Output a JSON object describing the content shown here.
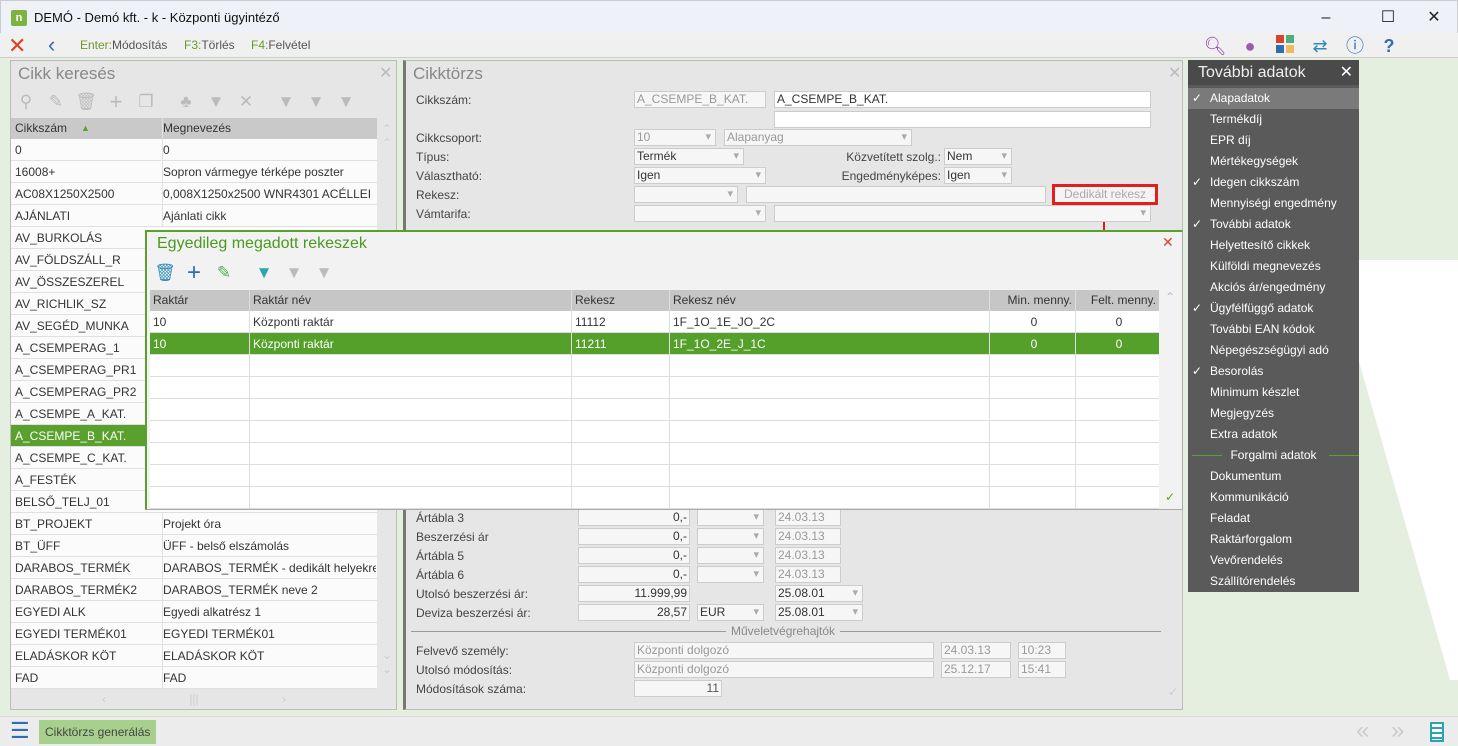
{
  "window": {
    "title": "DEMÓ - Demó kft. - k - Központi ügyintéző",
    "logo": "n"
  },
  "toolbar": {
    "keys": [
      {
        "key": "Enter:",
        "label": "Módosítás"
      },
      {
        "key": "F3:",
        "label": "Törlés"
      },
      {
        "key": "F4:",
        "label": "Felvétel"
      }
    ]
  },
  "search_panel": {
    "title": "Cikk keresés",
    "col1": "Cikkszám",
    "col2": "Megnevezés",
    "rows": [
      [
        "0",
        "0"
      ],
      [
        "16008+",
        "Sopron vármegye térképe poszter"
      ],
      [
        "AC08X1250X2500",
        "0,008X1250x2500 WNR4301 ACÉLLEI"
      ],
      [
        "AJÁNLATI",
        "Ajánlati cikk"
      ],
      [
        "AV_BURKOLÁS",
        ""
      ],
      [
        "AV_FÖLDSZÁLL_R",
        ""
      ],
      [
        "AV_ÖSSZESZEREL",
        ""
      ],
      [
        "AV_RICHLIK_SZ",
        ""
      ],
      [
        "AV_SEGÉD_MUNKA",
        ""
      ],
      [
        "A_CSEMPERAG_1",
        ""
      ],
      [
        "A_CSEMPERAG_PR1",
        ""
      ],
      [
        "A_CSEMPERAG_PR2",
        ""
      ],
      [
        "A_CSEMPE_A_KAT.",
        ""
      ],
      [
        "A_CSEMPE_B_KAT.",
        ""
      ],
      [
        "A_CSEMPE_C_KAT.",
        ""
      ],
      [
        "A_FESTÉK",
        ""
      ],
      [
        "BELSŐ_TELJ_01",
        ""
      ],
      [
        "BT_PROJEKT",
        "Projekt óra"
      ],
      [
        "BT_ÜFF",
        "ÜFF - belső elszámolás"
      ],
      [
        "DARABOS_TERMÉK",
        "DARABOS_TERMÉK - dedikált helyekre"
      ],
      [
        "DARABOS_TERMÉK2",
        "DARABOS_TERMÉK neve 2"
      ],
      [
        "EGYEDI ALK",
        "Egyedi alkatrész 1"
      ],
      [
        "EGYEDI TERMÉK01",
        "EGYEDI TERMÉK01"
      ],
      [
        "ELADÁSKOR KÖT",
        "ELADÁSKOR KÖT"
      ],
      [
        "FAD",
        "FAD"
      ]
    ],
    "selected_index": 13
  },
  "form": {
    "title": "Cikktörzs",
    "cikkszam_label": "Cikkszám:",
    "cikkszam_code": "A_CSEMPE_B_KAT.",
    "cikkszam_name": "A_CSEMPE_B_KAT.",
    "cikkcsoport_label": "Cikkcsoport:",
    "cikkcsoport_code": "10",
    "cikkcsoport_name": "Alapanyag",
    "tipus_label": "Típus:",
    "tipus": "Termék",
    "kozvetitett_label": "Közvetített szolg.:",
    "kozvetitett": "Nem",
    "valaszthato_label": "Választható:",
    "valaszthato": "Igen",
    "engedmeny_label": "Engedményképes:",
    "engedmeny": "Igen",
    "rekesz_label": "Rekesz:",
    "dedikalt_button": "Dedikált rekesz",
    "vamtarifa_label": "Vámtarifa:",
    "prices": [
      {
        "label": "Ártábla 3",
        "value": "0,-",
        "currency": "",
        "date": "24.03.13"
      },
      {
        "label": "Beszerzési ár",
        "value": "0,-",
        "currency": "",
        "date": "24.03.13"
      },
      {
        "label": "Ártábla 5",
        "value": "0,-",
        "currency": "",
        "date": "24.03.13"
      },
      {
        "label": "Ártábla 6",
        "value": "0,-",
        "currency": "",
        "date": "24.03.13"
      }
    ],
    "utolso_label": "Utolsó beszerzési ár:",
    "utolso_value": "11.999,99",
    "utolso_date": "25.08.01",
    "deviza_label": "Deviza beszerzési ár:",
    "deviza_value": "28,57",
    "deviza_currency": "EUR",
    "deviza_date": "25.08.01",
    "section": "Műveletvégrehajtók",
    "felvevo_label": "Felvevő személy:",
    "felvevo": "Központi dolgozó",
    "felvevo_date": "24.03.13",
    "felvevo_time": "10:23",
    "modositas_label": "Utolsó módosítás:",
    "modositas": "Központi dolgozó",
    "modositas_date": "25.12.17",
    "modositas_time": "15:41",
    "modszam_label": "Módosítások száma:",
    "modszam": "11"
  },
  "popup": {
    "title": "Egyedileg megadott rekeszek",
    "columns": [
      "Raktár",
      "Raktár név",
      "Rekesz",
      "Rekesz név",
      "Min. menny.",
      "Felt. menny."
    ],
    "rows": [
      [
        "10",
        "Központi raktár",
        "11112",
        "1F_1O_1E_JO_2C",
        "0",
        "0"
      ],
      [
        "10",
        "Központi raktár",
        "11211",
        "1F_1O_2E_J_1C",
        "0",
        "0"
      ]
    ],
    "selected_index": 1
  },
  "menu": {
    "title": "További adatok",
    "items": [
      {
        "label": "Alapadatok",
        "checked": true
      },
      {
        "label": "Termékdíj",
        "checked": false
      },
      {
        "label": "EPR díj",
        "checked": false
      },
      {
        "label": "Mértékegységek",
        "checked": false
      },
      {
        "label": "Idegen cikkszám",
        "checked": true
      },
      {
        "label": "Mennyiségi engedmény",
        "checked": false
      },
      {
        "label": "További adatok",
        "checked": true
      },
      {
        "label": "Helyettesítő cikkek",
        "checked": false
      },
      {
        "label": "Külföldi megnevezés",
        "checked": false
      },
      {
        "label": "Akciós ár/engedmény",
        "checked": false
      },
      {
        "label": "Ügyfélfüggő adatok",
        "checked": true
      },
      {
        "label": "További EAN kódok",
        "checked": false
      },
      {
        "label": "Népegészségügyi adó",
        "checked": false
      },
      {
        "label": "Besorolás",
        "checked": true
      },
      {
        "label": "Minimum készlet",
        "checked": false
      },
      {
        "label": "Megjegyzés",
        "checked": false
      },
      {
        "label": "Extra adatok",
        "checked": false
      }
    ],
    "section": "Forgalmi adatok",
    "items2": [
      "Dokumentum",
      "Kommunikáció",
      "Feladat",
      "Raktárforgalom",
      "Vevőrendelés",
      "Szállítórendelés"
    ]
  },
  "bottom": {
    "button": "Cikktörzs generálás"
  },
  "colors": {
    "accent": "#5aa02c",
    "menu_bg": "#5a5a5a"
  }
}
